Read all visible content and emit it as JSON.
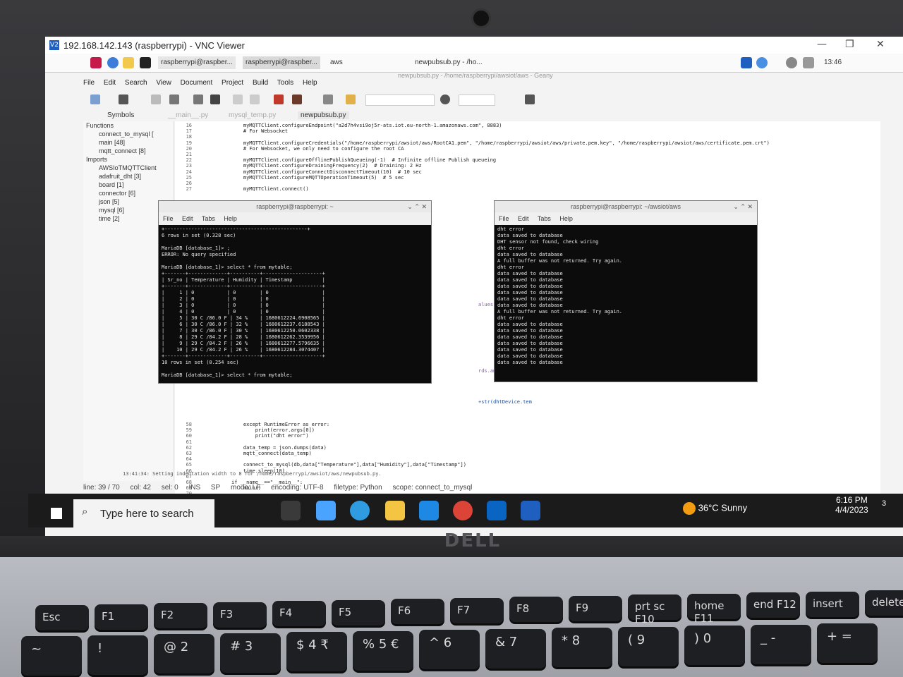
{
  "vnc": {
    "title": "192.168.142.143 (raspberrypi) - VNC Viewer",
    "logo": "V2"
  },
  "pi_panel": {
    "tasks": [
      "raspberrypi@raspber...",
      "raspberrypi@raspber...",
      "aws",
      "newpubsub.py - /ho..."
    ],
    "clock": "13:46"
  },
  "geany": {
    "window_title": "newpubsub.py - /home/raspberrypi/awsiot/aws - Geany",
    "menu": [
      "File",
      "Edit",
      "Search",
      "View",
      "Document",
      "Project",
      "Build",
      "Tools",
      "Help"
    ],
    "sidebar_tab": "Symbols",
    "tabs": [
      "__main__.py",
      "mysql_temp.py",
      "newpubsub.py"
    ],
    "symbols": [
      "Functions",
      "connect_to_mysql [",
      "main [48]",
      "mqtt_connect [8]",
      "Imports",
      "AWSIoTMQTTClient",
      "adafruit_dht [3]",
      "board [1]",
      "connector [6]",
      "json [5]",
      "mysql [6]",
      "time [2]"
    ],
    "code_top_lines": [
      "16",
      "17",
      "18",
      "19",
      "20",
      "21",
      "22",
      "23",
      "24",
      "25",
      "26",
      "27"
    ],
    "code_top": [
      "    myMQTTClient.configureEndpoint(\"a2d7h4vsi9oj5r-ats.iot.eu-north-1.amazonaws.com\", 8883)",
      "    # For Websocket",
      "",
      "    myMQTTClient.configureCredentials(\"/home/raspberrypi/awsiot/aws/RootCA1.pem\", \"/home/raspberrypi/awsiot/aws/private.pem.key\", \"/home/raspberrypi/awsiot/aws/certificate.pem.crt\")",
      "    # For Websocket, we only need to configure the root CA",
      "",
      "    myMQTTClient.configureOfflinePublishQueueing(-1)  # Infinite offline Publish queueing",
      "    myMQTTClient.configureDrainingFrequency(2)  # Draining: 2 Hz",
      "    myMQTTClient.configureConnectDisconnectTimeout(10)  # 10 sec",
      "    myMQTTClient.configureMQTTOperationTimeout(5)  # 5 sec",
      "",
      "    myMQTTClient.connect()"
    ],
    "code_mid": [
      "alues (%s,%s,%s)\"",
      "rds.amazonaws.com\"",
      "+str(dhtDevice.tem"
    ],
    "code_bottom_lines": [
      "58",
      "59",
      "60",
      "61",
      "62",
      "63",
      "64",
      "65",
      "66",
      "67",
      "68",
      "69",
      "70"
    ],
    "code_bottom": [
      "    except RuntimeError as error:",
      "        print(error.args[0])",
      "        print(\"dht error\")",
      "",
      "    data_temp = json.dumps(data)",
      "    mqtt_connect(data_temp)",
      "",
      "    connect_to_mysql(db,data[\"Temperature\"],data[\"Humidity\"],data[\"Timestamp\"])",
      "    time.sleep(10)",
      "",
      "if __name__==\"__main__\":",
      "    main()",
      ""
    ],
    "message_line": "13:41:34: Setting indentation width to 8 for /home/raspberrypi/awsiot/aws/newpubsub.py.",
    "status": [
      "line: 39 / 70",
      "col: 42",
      "sel: 0",
      "INS",
      "SP",
      "mode: LF",
      "encoding: UTF-8",
      "filetype: Python",
      "scope: connect_to_mysql"
    ]
  },
  "terminal_left": {
    "title": "raspberrypi@raspberrypi: ~",
    "menu": [
      "File",
      "Edit",
      "Tabs",
      "Help"
    ],
    "text": "+------------------------------------------------+\n6 rows in set (0.328 sec)\n\nMariaDB [database_1]> ;\nERROR: No query specified\n\nMariaDB [database_1]> select * from mytable;\n+-------+-------------+----------+--------------------+\n| Sr_no | Temperature | Humidity | Timestamp          |\n+-------+-------------+----------+--------------------+\n|     1 | 0           | 0        | 0                  |\n|     2 | 0           | 0        | 0                  |\n|     3 | 0           | 0        | 0                  |\n|     4 | 0           | 0        | 0                  |\n|     5 | 30 C /86.0 F | 34 %    | 1680612224.6908565 |\n|     6 | 30 C /86.0 F | 32 %    | 1680612237.6188543 |\n|     7 | 30 C /86.0 F | 30 %    | 1680612250.0602338 |\n|     8 | 29 C /84.2 F | 28 %    | 1680612262.3539956 |\n|     9 | 29 C /84.2 F | 26 %    | 1680612277.5796635 |\n|    10 | 29 C /84.2 F | 26 %    | 1680612284.3074407 |\n+-------+-------------+----------+--------------------+\n10 rows in set (0.254 sec)\n\nMariaDB [database_1]> select * from mytable;"
  },
  "terminal_right": {
    "title": "raspberrypi@raspberrypi: ~/awsiot/aws",
    "menu": [
      "File",
      "Edit",
      "Tabs",
      "Help"
    ],
    "text": "dht error\ndata saved to database\nDHT sensor not found, check wiring\ndht error\ndata saved to database\nA full buffer was not returned. Try again.\ndht error\ndata saved to database\ndata saved to database\ndata saved to database\ndata saved to database\ndata saved to database\ndata saved to database\nA full buffer was not returned. Try again.\ndht error\ndata saved to database\ndata saved to database\ndata saved to database\ndata saved to database\ndata saved to database\ndata saved to database\ndata saved to database"
  },
  "windows": {
    "search_placeholder": "Type here to search",
    "weather": "36°C  Sunny",
    "time": "6:16 PM",
    "date": "4/4/2023",
    "notif_count": "3"
  },
  "laptop": {
    "brand": "DELL",
    "keys_fn": [
      "Esc",
      "F1",
      "F2",
      "F3",
      "F4",
      "F5",
      "F6",
      "F7",
      "F8",
      "F9",
      "prt sc F10",
      "home F11",
      "end F12",
      "insert",
      "delete"
    ],
    "keys_num": [
      "~",
      "!",
      "@ 2",
      "# 3",
      "$ 4 ₹",
      "% 5 €",
      "^ 6",
      "& 7",
      "* 8",
      "( 9",
      ") 0",
      "_ -",
      "+ ="
    ]
  },
  "colors": {
    "terminal_bg": "#0c0c0c",
    "vnc_blue": "#1f5fbf",
    "taskbar": "#1b1b1b"
  }
}
